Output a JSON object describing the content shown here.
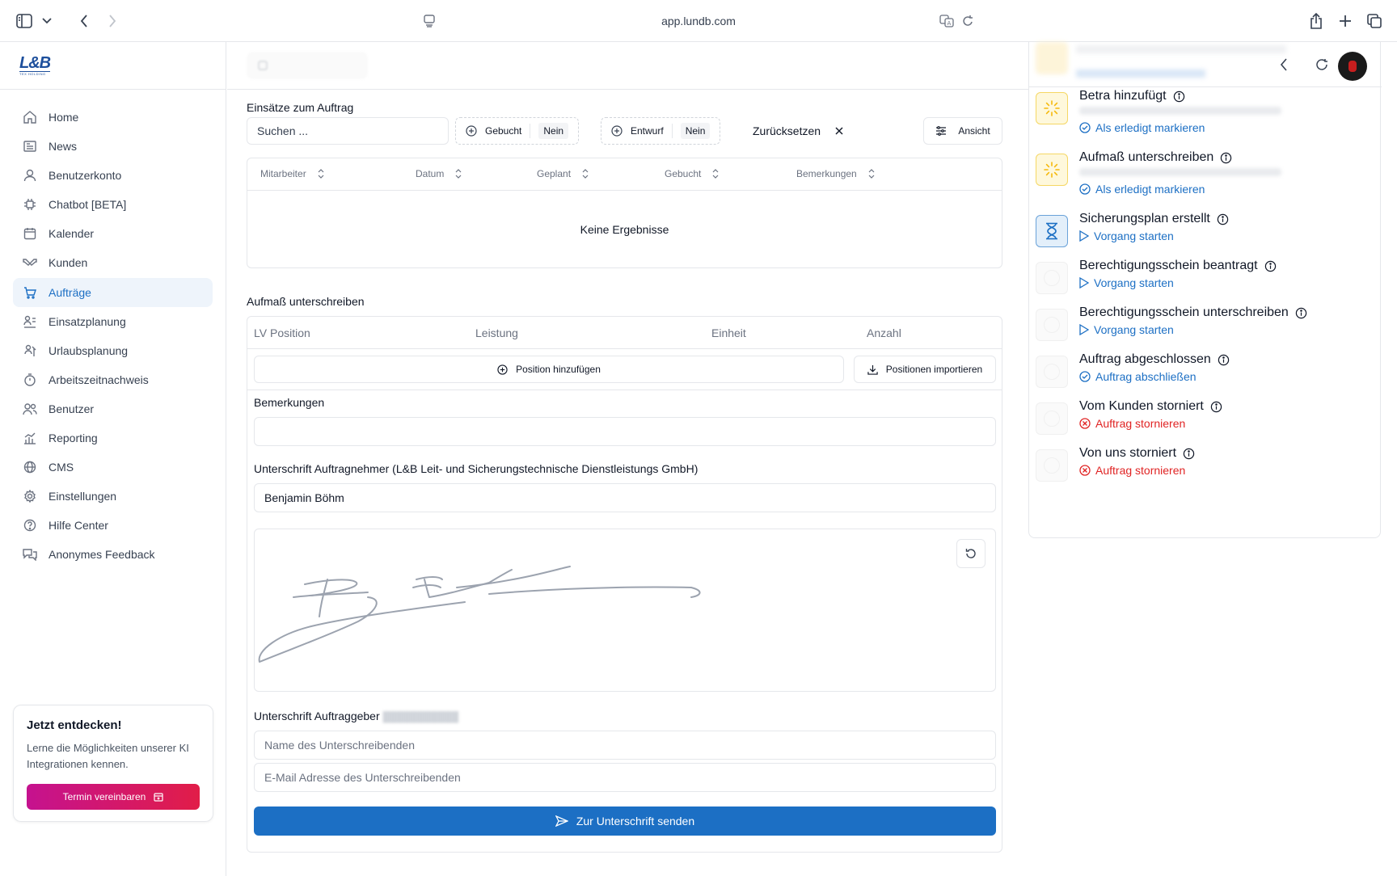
{
  "browser": {
    "url": "app.lundb.com"
  },
  "sidebar": {
    "logo_text": "L&B",
    "logo_sub": "TEX HOLDING",
    "items": [
      {
        "label": "Home",
        "icon": "home-icon"
      },
      {
        "label": "News",
        "icon": "newspaper-icon"
      },
      {
        "label": "Benutzerkonto",
        "icon": "user-icon"
      },
      {
        "label": "Chatbot [BETA]",
        "icon": "chip-icon"
      },
      {
        "label": "Kalender",
        "icon": "calendar-icon"
      },
      {
        "label": "Kunden",
        "icon": "handshake-icon"
      },
      {
        "label": "Aufträge",
        "icon": "cart-icon",
        "active": true
      },
      {
        "label": "Einsatzplanung",
        "icon": "planning-icon"
      },
      {
        "label": "Urlaubsplanung",
        "icon": "vacation-icon"
      },
      {
        "label": "Arbeitszeitnachweis",
        "icon": "timer-icon"
      },
      {
        "label": "Benutzer",
        "icon": "users-icon"
      },
      {
        "label": "Reporting",
        "icon": "chart-icon"
      },
      {
        "label": "CMS",
        "icon": "globe-icon"
      },
      {
        "label": "Einstellungen",
        "icon": "gear-icon"
      },
      {
        "label": "Hilfe Center",
        "icon": "help-icon"
      },
      {
        "label": "Anonymes Feedback",
        "icon": "feedback-icon"
      }
    ],
    "promo": {
      "title": "Jetzt entdecken!",
      "text": "Lerne die Möglichkeiten unserer KI Integrationen kennen.",
      "button": "Termin vereinbaren"
    }
  },
  "einsaetze": {
    "title": "Einsätze zum Auftrag",
    "search_placeholder": "Suchen ...",
    "filter_gebucht": {
      "label": "Gebucht",
      "value": "Nein"
    },
    "filter_entwurf": {
      "label": "Entwurf",
      "value": "Nein"
    },
    "reset_label": "Zurücksetzen",
    "view_label": "Ansicht",
    "columns": [
      "Mitarbeiter",
      "Datum",
      "Geplant",
      "Gebucht",
      "Bemerkungen"
    ],
    "empty_text": "Keine Ergebnisse"
  },
  "aufmass": {
    "title": "Aufmaß unterschreiben",
    "columns": [
      "LV Position",
      "Leistung",
      "Einheit",
      "Anzahl"
    ],
    "add_position": "Position hinzufügen",
    "import_positions": "Positionen importieren",
    "remarks_label": "Bemerkungen",
    "contractor_sig_label": "Unterschrift Auftragnehmer (L&B Leit- und Sicherungstechnische Dienstleistungs GmbH)",
    "contractor_name": "Benjamin Böhm",
    "client_sig_label": "Unterschrift Auftraggeber",
    "name_placeholder": "Name des Unterschreibenden",
    "email_placeholder": "E-Mail Adresse des Unterschreibenden",
    "send_button": "Zur Unterschrift senden"
  },
  "steps": [
    {
      "title": "Betra hinzufügt",
      "action": "Als erledigt markieren",
      "type": "done",
      "icon_style": "yellow"
    },
    {
      "title": "Aufmaß unterschreiben",
      "action": "Als erledigt markieren",
      "type": "done",
      "icon_style": "yellow"
    },
    {
      "title": "Sicherungsplan erstellt",
      "action": "Vorgang starten",
      "type": "start",
      "icon_style": "blue"
    },
    {
      "title": "Berechtigungsschein beantragt",
      "action": "Vorgang starten",
      "type": "start",
      "icon_style": "grey"
    },
    {
      "title": "Berechtigungsschein unterschreiben",
      "action": "Vorgang starten",
      "type": "start",
      "icon_style": "grey"
    },
    {
      "title": "Auftrag abgeschlossen",
      "action": "Auftrag abschließen",
      "type": "done",
      "icon_style": "grey"
    },
    {
      "title": "Vom Kunden storniert",
      "action": "Auftrag stornieren",
      "type": "cancel",
      "icon_style": "grey"
    },
    {
      "title": "Von uns storniert",
      "action": "Auftrag stornieren",
      "type": "cancel",
      "icon_style": "grey"
    }
  ],
  "colors": {
    "accent": "#1c6fc4",
    "danger": "#e02424",
    "promo_gradient_start": "#c5128f",
    "promo_gradient_end": "#e11d48"
  }
}
